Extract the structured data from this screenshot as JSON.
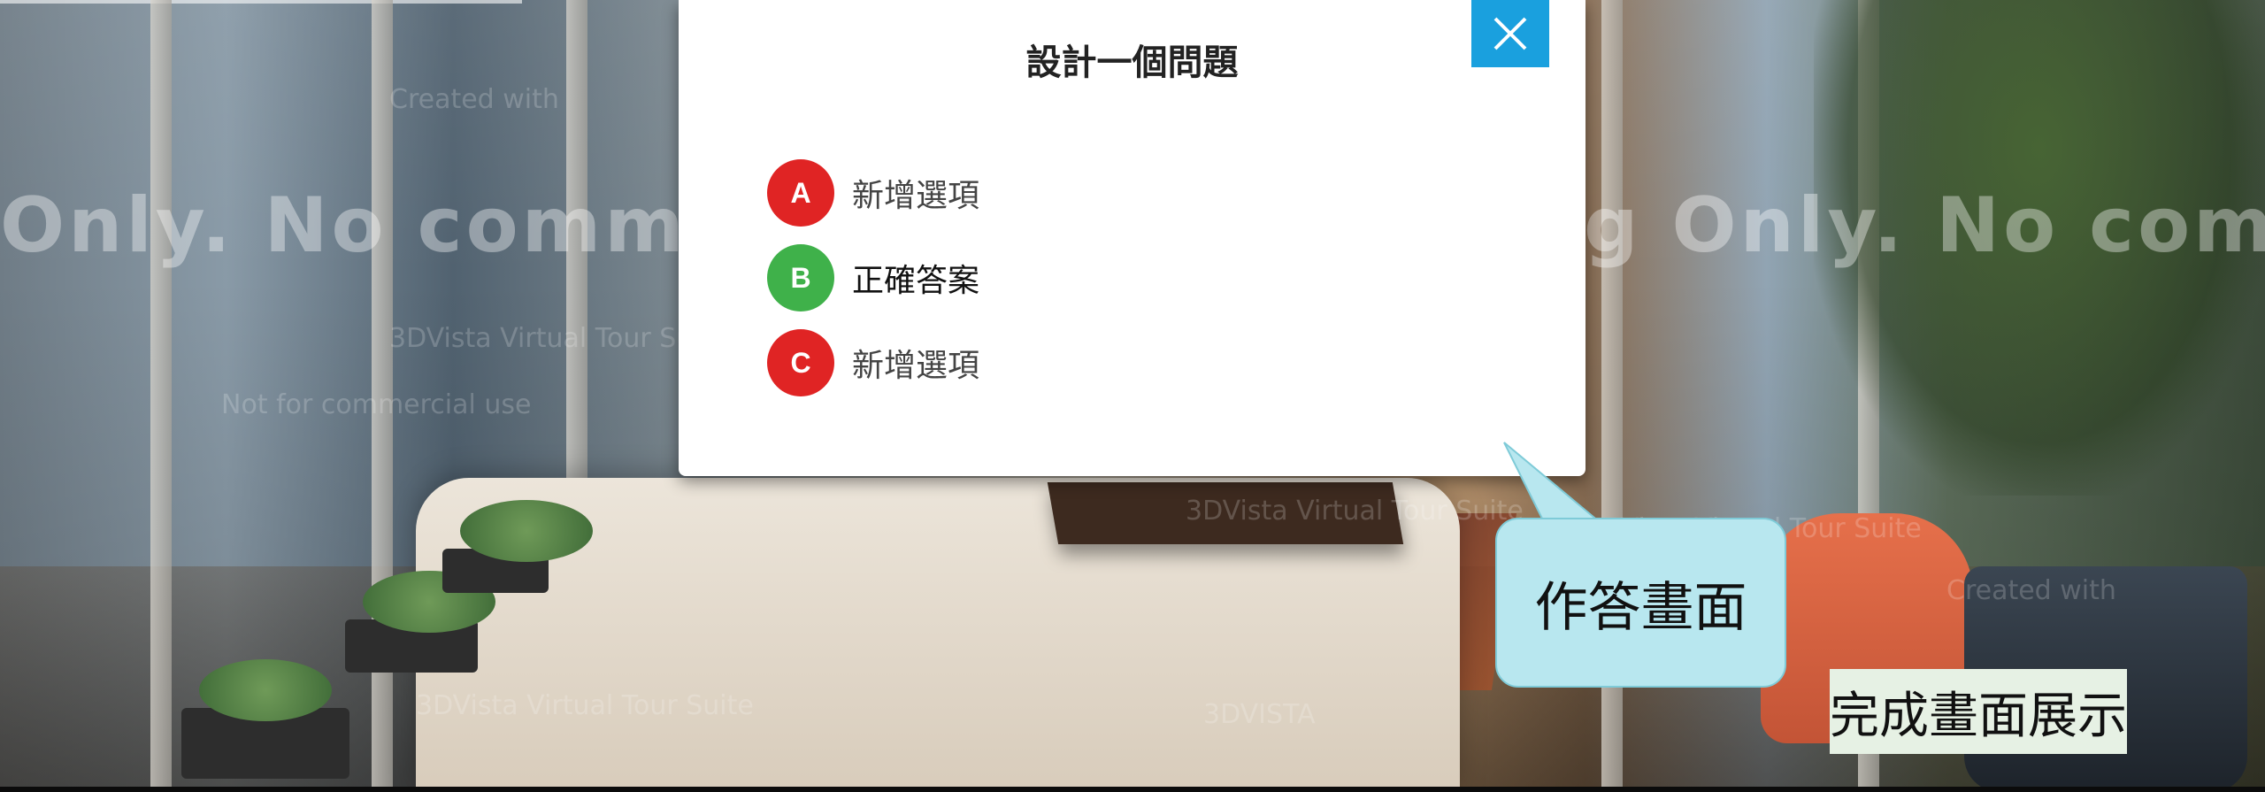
{
  "dialog": {
    "title": "設計一個問題",
    "options": [
      {
        "letter": "A",
        "text": "新增選項",
        "color": "#e02424"
      },
      {
        "letter": "B",
        "text": "正確答案",
        "color": "#3fb14a"
      },
      {
        "letter": "C",
        "text": "新增選項",
        "color": "#e02424"
      }
    ],
    "close_icon": "close-icon",
    "close_color": "#1aa0de"
  },
  "annotation": {
    "bubble_text": "作答畫面",
    "caption_text": "完成畫面展示"
  },
  "watermark": {
    "left": "Only. No comm",
    "right": "g Only. No com",
    "small_1": "Created with",
    "small_2": "3DVista Virtual Tour Suite",
    "small_3": "Not for commercial use",
    "small_4": "3DVISTA"
  }
}
